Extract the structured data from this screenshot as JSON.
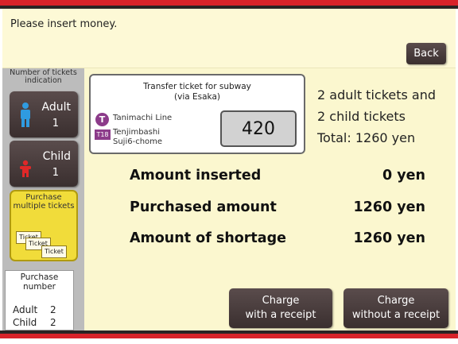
{
  "header": {
    "message": "Please insert money.",
    "back_label": "Back"
  },
  "left_panel": {
    "indication_title": "Number of tickets indication",
    "adult": {
      "label": "Adult",
      "count": "1"
    },
    "child": {
      "label": "Child",
      "count": "1"
    },
    "multiple": {
      "label": "Purchase multiple tickets",
      "ticket_word": "Ticket"
    },
    "purchase_number": {
      "title": "Purchase number",
      "adult_label": "Adult",
      "adult_value": "2",
      "child_label": "Child",
      "child_value": "2"
    }
  },
  "ticket": {
    "title_line1": "Transfer ticket for subway",
    "title_line2": "(via Esaka)",
    "line_icon": "T",
    "line_name": "Tanimachi Line",
    "station_code": "T18",
    "station_line1": "Tenjimbashi",
    "station_line2": "Suji6-chome",
    "price": "420"
  },
  "summary": {
    "line1": "2 adult tickets and",
    "line2": "2 child tickets",
    "line3": "Total: 1260 yen"
  },
  "amounts": [
    {
      "label": "Amount inserted",
      "value": "0 yen"
    },
    {
      "label": "Purchased amount",
      "value": "1260 yen"
    },
    {
      "label": "Amount of shortage",
      "value": "1260 yen"
    }
  ],
  "buttons": {
    "receipt_line1": "Charge",
    "receipt_line2": "with a receipt",
    "noreceipt_line1": "Charge",
    "noreceipt_line2": "without a receipt"
  },
  "colors": {
    "accent_red": "#d8232a",
    "button_dark": "#3a2f2f",
    "tanimachi_purple": "#8c3b8a",
    "multiple_yellow": "#f1dc3a",
    "screen_bg": "#fbf7cf"
  },
  "icons": {
    "adult": "adult-person-icon",
    "child": "child-person-icon",
    "line": "tanimachi-line-icon"
  }
}
